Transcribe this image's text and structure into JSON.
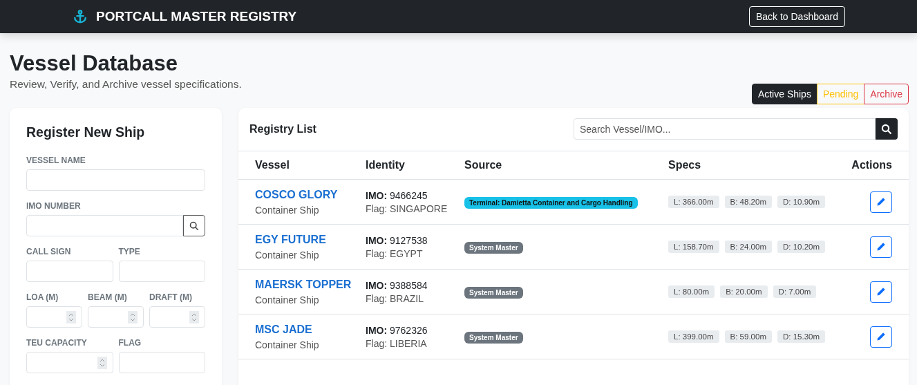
{
  "header": {
    "brand": "PORTCALL MASTER REGISTRY",
    "back_button": "Back to Dashboard"
  },
  "page": {
    "title": "Vessel Database",
    "subtitle": "Review, Verify, and Archive vessel specifications."
  },
  "tabs": [
    {
      "label": "Active Ships",
      "selected": true,
      "color": "#212529"
    },
    {
      "label": "Pending",
      "selected": false,
      "color": "#ffc107"
    },
    {
      "label": "Archive",
      "selected": false,
      "color": "#dc3545"
    }
  ],
  "form": {
    "title": "Register New Ship",
    "rows": [
      [
        {
          "label": "VESSEL NAME",
          "kind": "text"
        }
      ],
      [
        {
          "label": "IMO NUMBER",
          "kind": "lookup"
        }
      ],
      [
        {
          "label": "CALL SIGN",
          "kind": "text"
        },
        {
          "label": "TYPE",
          "kind": "text"
        }
      ],
      [
        {
          "label": "LOA (M)",
          "kind": "number"
        },
        {
          "label": "BEAM (M)",
          "kind": "number"
        },
        {
          "label": "DRAFT (M)",
          "kind": "number"
        }
      ],
      [
        {
          "label": "TEU CAPACITY",
          "kind": "number"
        },
        {
          "label": "FLAG",
          "kind": "text"
        }
      ]
    ]
  },
  "registry": {
    "title": "Registry List",
    "search": {
      "placeholder": "Search Vessel/IMO..."
    },
    "columns": [
      "Vessel",
      "Identity",
      "Source",
      "Specs",
      "Actions"
    ],
    "rows": [
      {
        "name": "COSCO GLORY",
        "type": "Container Ship",
        "imo": "**IMO:** 9466245",
        "flag": "Flag: SINGAPORE",
        "source": {
          "kind": "terminal",
          "label": "Terminal: Damietta Container and Cargo Handling"
        },
        "specs": [
          "L: 366.00m",
          "B: 48.20m",
          "D: 10.90m"
        ]
      },
      {
        "name": "EGY FUTURE",
        "type": "Container Ship",
        "imo": "**IMO:** 9127538",
        "flag": "Flag: EGYPT",
        "source": {
          "kind": "system",
          "label": "System Master"
        },
        "specs": [
          "L: 158.70m",
          "B: 24.00m",
          "D: 10.20m"
        ]
      },
      {
        "name": "MAERSK TOPPER",
        "type": "Container Ship",
        "imo": "**IMO:** 9388584",
        "flag": "Flag: BRAZIL",
        "source": {
          "kind": "system",
          "label": "System Master"
        },
        "specs": [
          "L: 80.00m",
          "B: 20.00m",
          "D: 7.00m"
        ]
      },
      {
        "name": "MSC JADE",
        "type": "Container Ship",
        "imo": "**IMO:** 9762326",
        "flag": "Flag: LIBERIA",
        "source": {
          "kind": "system",
          "label": "System Master"
        },
        "specs": [
          "L: 399.00m",
          "B: 59.00m",
          "D: 15.30m"
        ]
      }
    ]
  }
}
